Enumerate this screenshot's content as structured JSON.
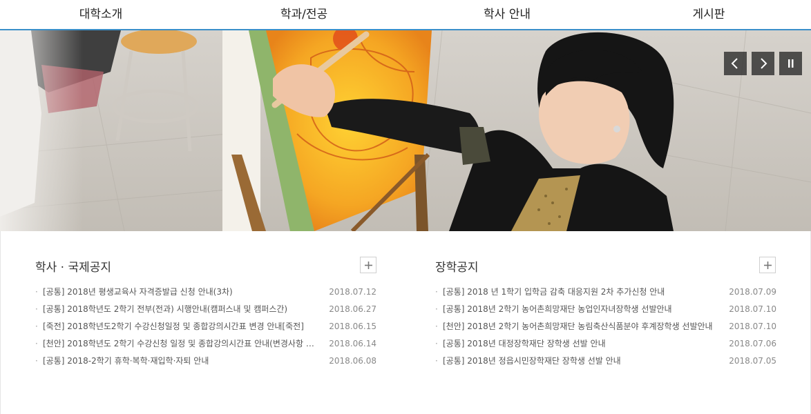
{
  "nav": {
    "items": [
      "대학소개",
      "학과/전공",
      "학사 안내",
      "게시판"
    ]
  },
  "hero": {
    "controls": {
      "prev_icon": "chevron-left-icon",
      "next_icon": "chevron-right-icon",
      "pause_icon": "pause-icon"
    }
  },
  "panels": [
    {
      "title": "학사 · 국제공지",
      "more_icon": "plus-icon",
      "items": [
        {
          "title": "[공통] 2018년 평생교육사 자격증발급 신청 안내(3차)",
          "date": "2018.07.12"
        },
        {
          "title": "[공통] 2018학년도 2학기 전부(전과) 시행안내(캠퍼스내 및 캠퍼스간)",
          "date": "2018.06.27"
        },
        {
          "title": "[죽전] 2018학년도2학기 수강신청일정 및 종합강의시간표 변경 안내[죽전]",
          "date": "2018.06.15"
        },
        {
          "title": "[천안] 2018학년도 2학기 수강신청 일정 및 종합강의시간표 안내(변경사항 …",
          "date": "2018.06.14"
        },
        {
          "title": "[공통] 2018-2학기 휴학·복학·재입학·자퇴 안내",
          "date": "2018.06.08"
        }
      ]
    },
    {
      "title": "장학공지",
      "more_icon": "plus-icon",
      "items": [
        {
          "title": "[공통] 2018 년 1학기 입학금 감축 대응지원 2차 추가신청 안내",
          "date": "2018.07.09"
        },
        {
          "title": "[공통] 2018년 2학기 농어촌희망재단 농업인자녀장학생 선발안내",
          "date": "2018.07.10"
        },
        {
          "title": "[천안] 2018년 2학기 농어촌희망재단 농림축산식품분야 후계장학생 선발안내",
          "date": "2018.07.10"
        },
        {
          "title": "[공통] 2018년 대정장학재단 장학생 선발 안내",
          "date": "2018.07.06"
        },
        {
          "title": "[공통] 2018년 정읍시민장학재단 장학생 선발 안내",
          "date": "2018.07.05"
        }
      ]
    }
  ],
  "colors": {
    "nav_underline": "#3a8fc9",
    "control_bg": "#282828"
  }
}
